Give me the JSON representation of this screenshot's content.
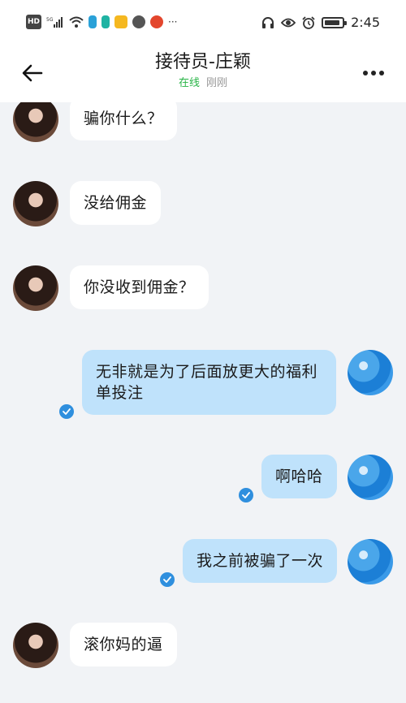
{
  "status_bar": {
    "hd": "HD",
    "network": "5G",
    "time": "2:45"
  },
  "header": {
    "title": "接待员-庄颖",
    "status": "在线",
    "last_seen": "刚刚"
  },
  "colors": {
    "online": "#28b446",
    "outgoing_bubble": "#bfe2fb",
    "incoming_bubble": "#ffffff",
    "read_check": "#2f8fde",
    "background": "#f1f3f6"
  },
  "messages": [
    {
      "direction": "in",
      "text": "骗你什么？"
    },
    {
      "direction": "in",
      "text": "没给佣金"
    },
    {
      "direction": "in",
      "text": "你没收到佣金？"
    },
    {
      "direction": "out",
      "text": "无非就是为了后面放更大的福利单投注",
      "read": true
    },
    {
      "direction": "out",
      "text": "啊哈哈",
      "read": true
    },
    {
      "direction": "out",
      "text": "我之前被骗了一次",
      "read": true
    },
    {
      "direction": "in",
      "text": "滚你妈的逼"
    }
  ]
}
